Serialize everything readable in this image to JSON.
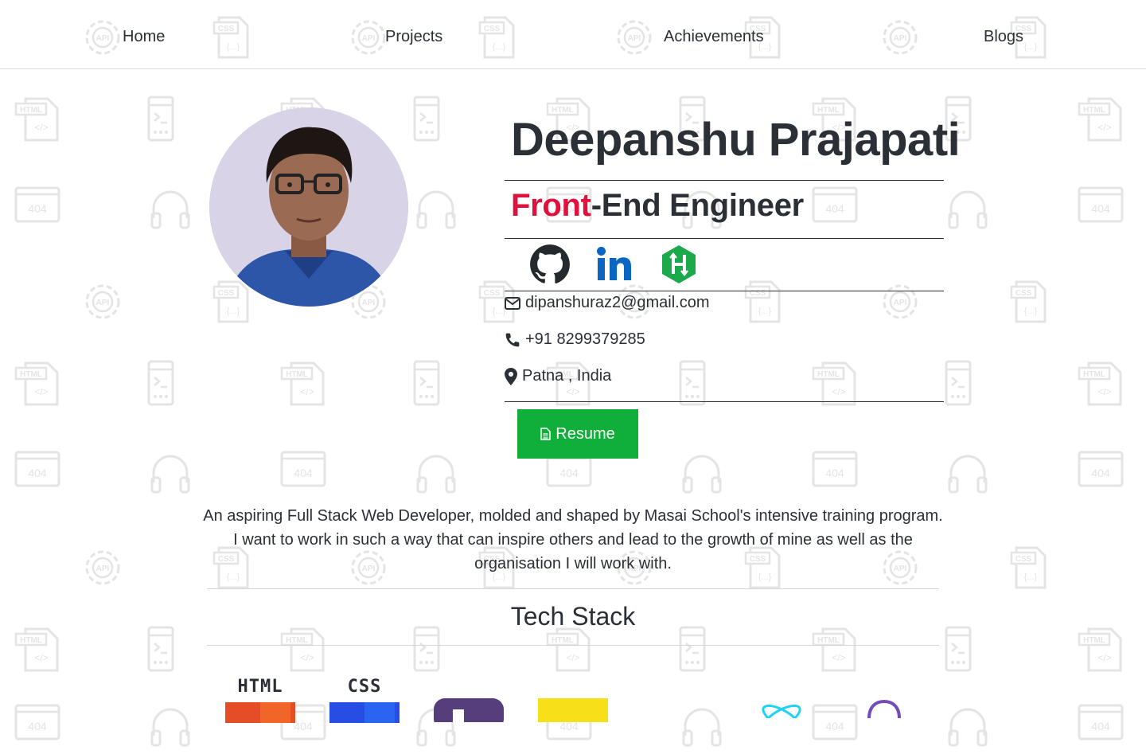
{
  "nav": {
    "items": [
      {
        "label": "Home"
      },
      {
        "label": "Projects"
      },
      {
        "label": "Achievements"
      },
      {
        "label": "Blogs"
      }
    ]
  },
  "profile": {
    "name": "Deepanshu Prajapati",
    "role_accent": "Front",
    "role_rest": "-End Engineer",
    "email": "dipanshuraz2@gmail.com",
    "phone": "+91 8299379285",
    "location": "Patna , India",
    "resume_label": "Resume"
  },
  "social": [
    {
      "name": "github-icon",
      "color": "#24292e"
    },
    {
      "name": "linkedin-icon",
      "color": "#0a66c2"
    },
    {
      "name": "hackerrank-icon",
      "color": "#1ba94c"
    }
  ],
  "bio": "An aspiring Full Stack Web Developer, molded and shaped by Masai School's intensive training program. I want to work in such a way that can inspire others and lead to the growth of mine as well as the organisation I will work with.",
  "tech_stack": {
    "title": "Tech Stack",
    "html_label": "HTML",
    "css_label": "CSS",
    "items": [
      "html5-icon",
      "css3-icon",
      "bootstrap-icon",
      "javascript-icon",
      "react-icon",
      "redux-icon"
    ]
  },
  "colors": {
    "accent_red": "#e0113d",
    "resume_green": "#0faf3a",
    "text": "#2b2f36"
  }
}
